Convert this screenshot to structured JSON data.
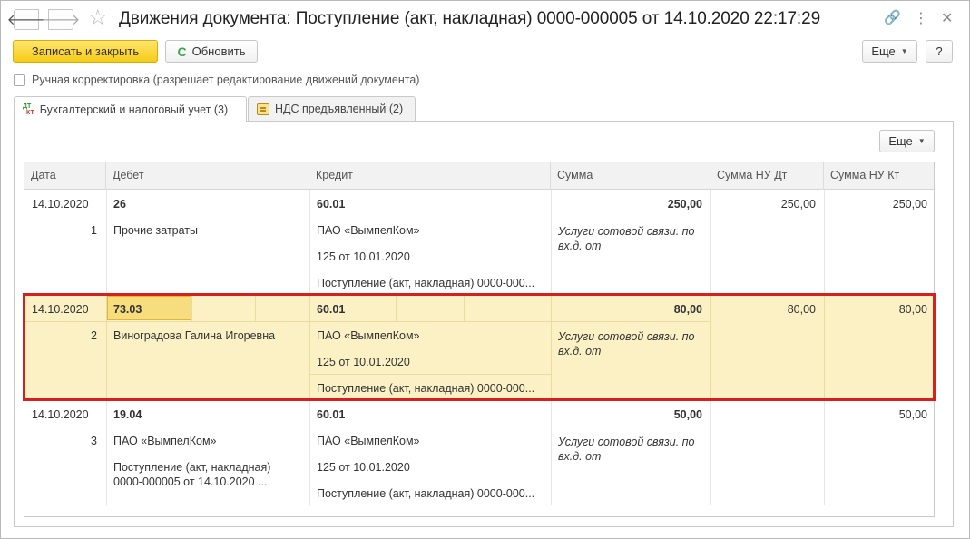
{
  "window": {
    "title": "Движения документа: Поступление (акт, накладная) 0000-000005 от 14.10.2020 22:17:29",
    "nav_back": "🡐",
    "nav_forward": "🡒",
    "star": "☆",
    "link_icon": "🔗",
    "menu_icon": "⋮",
    "close_icon": "✕"
  },
  "toolbar": {
    "save_close_label": "Записать и закрыть",
    "refresh_label": "Обновить",
    "refresh_glyph": "C",
    "more_label": "Еще",
    "help_label": "?"
  },
  "manual_edit": {
    "label": "Ручная корректировка (разрешает редактирование движений документа)",
    "checked": false
  },
  "tabs": [
    {
      "label": "Бухгалтерский и налоговый учет (3)",
      "active": true,
      "icon": "dt-kt-icon"
    },
    {
      "label": "НДС предъявленный (2)",
      "active": false,
      "icon": "nds-icon"
    }
  ],
  "table_toolbar": {
    "more_label": "Еще"
  },
  "table": {
    "columns": [
      "Дата",
      "Дебет",
      "Кредит",
      "Сумма",
      "Сумма НУ Дт",
      "Сумма НУ Кт"
    ],
    "rows": [
      {
        "date": "14.10.2020",
        "num": "1",
        "debit_account": "26",
        "debit_sub": [
          "Прочие затраты"
        ],
        "credit_account": "60.01",
        "credit_sub": [
          "ПАО «ВымпелКом»",
          "125 от 10.01.2020",
          "Поступление (акт, накладная) 0000-000..."
        ],
        "sum": "250,00",
        "content": "Услуги сотовой связи. по вх.д.  от",
        "nu_dt": "250,00",
        "nu_kt": "250,00"
      },
      {
        "date": "14.10.2020",
        "num": "2",
        "debit_account": "73.03",
        "debit_sub": [
          "Виноградова Галина Игоревна"
        ],
        "credit_account": "60.01",
        "credit_sub": [
          "ПАО «ВымпелКом»",
          "125 от 10.01.2020",
          "Поступление (акт, накладная) 0000-000..."
        ],
        "sum": "80,00",
        "content": "Услуги сотовой связи. по вх.д.  от",
        "nu_dt": "80,00",
        "nu_kt": "80,00"
      },
      {
        "date": "14.10.2020",
        "num": "3",
        "debit_account": "19.04",
        "debit_sub": [
          "ПАО «ВымпелКом»",
          "Поступление (акт, накладная)",
          "0000-000005 от 14.10.2020 ..."
        ],
        "credit_account": "60.01",
        "credit_sub": [
          "ПАО «ВымпелКом»",
          "125 от 10.01.2020",
          "Поступление (акт, накладная) 0000-000..."
        ],
        "sum": "50,00",
        "content": "Услуги сотовой связи. по вх.д.  от",
        "nu_dt": "",
        "nu_kt": "50,00"
      }
    ]
  },
  "colors": {
    "primary_button": "#f6cc16",
    "selected_row": "#fbf1c5",
    "highlight_border": "#d62020"
  }
}
